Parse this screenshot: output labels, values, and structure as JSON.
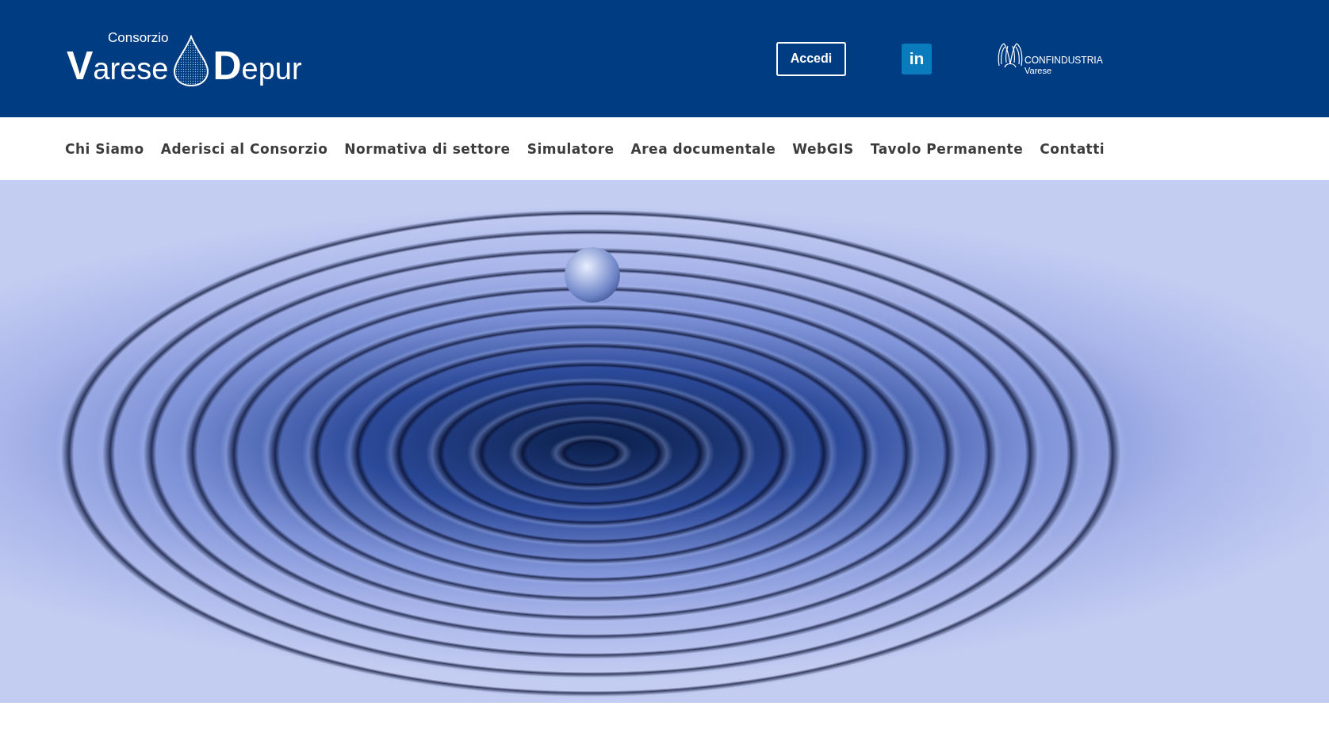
{
  "header": {
    "logo": {
      "top": "Consorzio",
      "left": "Varese",
      "right": "Depur"
    },
    "login_button": "Accedi",
    "social_button": "in",
    "partner": {
      "name": "CONFINDUSTRIA",
      "city": "Varese"
    }
  },
  "nav": [
    {
      "label": "Chi Siamo"
    },
    {
      "label": "Aderisci al Consorzio"
    },
    {
      "label": "Normativa di settore"
    },
    {
      "label": "Simulatore"
    },
    {
      "label": "Area documentale"
    },
    {
      "label": "WebGIS"
    },
    {
      "label": "Tavolo Permanente"
    },
    {
      "label": "Contatti"
    }
  ]
}
